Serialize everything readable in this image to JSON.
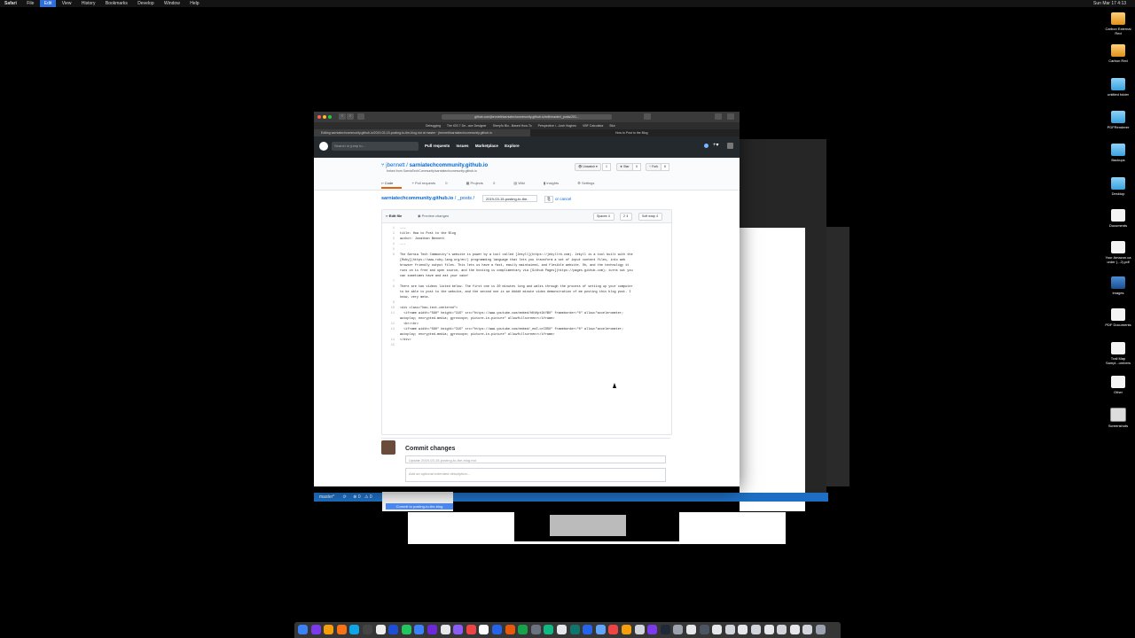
{
  "menubar": {
    "app": "Safari",
    "items": [
      "File",
      "Edit",
      "View",
      "History",
      "Bookmarks",
      "Develop",
      "Window",
      "Help"
    ],
    "clock": "Sun Mar 17 4:13"
  },
  "desktop_icons": [
    {
      "label": "Carbon External Red",
      "kind": "drive"
    },
    {
      "label": "Carbon Red",
      "kind": "drive"
    },
    {
      "label": "untitled folder",
      "kind": "folder"
    },
    {
      "label": "PDFRenderer",
      "kind": "folder"
    },
    {
      "label": "Backups",
      "kind": "folder"
    },
    {
      "label": "Desktop",
      "kind": "folder"
    },
    {
      "label": "Documents",
      "kind": "doc"
    },
    {
      "label": "Your Amazon.ca order (...2).pdf",
      "kind": "doc"
    },
    {
      "label": "Images",
      "kind": "img"
    },
    {
      "label": "PDF Documents",
      "kind": "doc"
    },
    {
      "label": "Trail Map Sampl...umbers",
      "kind": "doc"
    },
    {
      "label": "Other",
      "kind": "doc"
    },
    {
      "label": "Screenshots",
      "kind": "shot"
    }
  ],
  "browser": {
    "url": "github.com/jbennett/sarniatechcommunity.github.io/edit/master/_posts/201...",
    "bookmarks": [
      "Debugging",
      "The iOS 7 De...ace Designer",
      "Sheryl's Blo...Based How-To",
      "Perspective i...Josh Hughes",
      "VBF Calculator",
      "Blur"
    ],
    "tabs": [
      "Editing sarniatechcommunity.github.io/2019-03-15-posting-to-the-blog.md at master · jbennett/sarniatechcommunity.github.io",
      "How to Post to the Blog"
    ]
  },
  "github": {
    "search_placeholder": "Search or jump to...",
    "nav": [
      "Pull requests",
      "Issues",
      "Marketplace",
      "Explore"
    ],
    "owner": "jbennett",
    "repo": "sarniatechcommunity.github.io",
    "forked_from": "forked from SarniaTechCommunity/sarniatechcommunity.github.io",
    "unwatch": "Unwatch",
    "unwatch_count": "1",
    "star": "Star",
    "star_count": "0",
    "fork": "Fork",
    "fork_count": "6",
    "repo_tabs": [
      {
        "label": "Code"
      },
      {
        "label": "Pull requests",
        "count": "0"
      },
      {
        "label": "Projects",
        "count": "0"
      },
      {
        "label": "Wiki"
      },
      {
        "label": "Insights"
      },
      {
        "label": "Settings"
      }
    ],
    "breadcrumb_repo": "sarniatechcommunity.github.io",
    "breadcrumb_dir": "_posts",
    "filename": "2019-03-15-posting-to-the-",
    "cancel": "or cancel",
    "editor_tabs": [
      "Edit file",
      "Preview changes"
    ],
    "indent_mode": "Spaces",
    "indent_size": "2",
    "wrap_mode": "Soft wrap",
    "code_lines": [
      {
        "n": "1",
        "t": "---"
      },
      {
        "n": "2",
        "t": "title: How to Post to the Blog"
      },
      {
        "n": "3",
        "t": "author: Jonathan Bennett"
      },
      {
        "n": "4",
        "t": "---"
      },
      {
        "n": "5",
        "t": ""
      },
      {
        "n": "6",
        "t": "The Sarnia Tech Community's website is power by a tool called [Jekyll](https://jekyllrb.com). Jekyll is a tool built with the"
      },
      {
        "n": "",
        "t": "[Ruby](https://www.ruby-lang.org/en/) programming language that lets you transform a set of input content files, into web"
      },
      {
        "n": "",
        "t": "browser friendly output files. This lets us have a fast, easily maintained, and flexible website. Oh, and the technology it"
      },
      {
        "n": "",
        "t": "runs on is free and open source, and the hosting is complimentary via [Github Pages](https://pages.github.com); turns out you"
      },
      {
        "n": "",
        "t": "can sometimes have and eat your cake!"
      },
      {
        "n": "7",
        "t": ""
      },
      {
        "n": "8",
        "t": "There are two videos listed below. The first one is 20 minutes long and walks through the process of setting up your computer"
      },
      {
        "n": "",
        "t": "to be able to post to the website, and the second one is an ##### minute video demonstration of me posting this blog post. I"
      },
      {
        "n": "",
        "t": "know, very meta."
      },
      {
        "n": "9",
        "t": ""
      },
      {
        "n": "10",
        "t": "<div class=\"has-text-centered\">"
      },
      {
        "n": "11",
        "t": "  <iframe width=\"560\" height=\"315\" src=\"https://www.youtube.com/embed/hKtKpt9tYBU\" frameborder=\"0\" allow=\"accelerometer;"
      },
      {
        "n": "",
        "t": "autoplay; encrypted-media; gyroscope; picture-in-picture\" allowfullscreen></iframe>"
      },
      {
        "n": "12",
        "t": "  <br><br>"
      },
      {
        "n": "13",
        "t": "  <iframe width=\"560\" height=\"315\" src=\"https://www.youtube.com/embed/_eeZ-orIDSU\" frameborder=\"0\" allow=\"accelerometer;"
      },
      {
        "n": "",
        "t": "autoplay; encrypted-media; gyroscope; picture-in-picture\" allowfullscreen></iframe>"
      },
      {
        "n": "14",
        "t": "</div>"
      },
      {
        "n": "15",
        "t": ""
      }
    ],
    "commit_title": "Commit changes",
    "commit_summary_placeholder": "Update 2019-03-15-posting-to-the-blog.md",
    "commit_desc_placeholder": "Add an optional extended description..."
  },
  "vscode": {
    "branch": "master*",
    "errors": "0",
    "warnings": "0",
    "commit_button": "Commit to posting-to-the-blog"
  },
  "colors": {
    "github_header": "#24292e",
    "link": "#0366d6",
    "vscode_status": "#1e6fc3"
  }
}
